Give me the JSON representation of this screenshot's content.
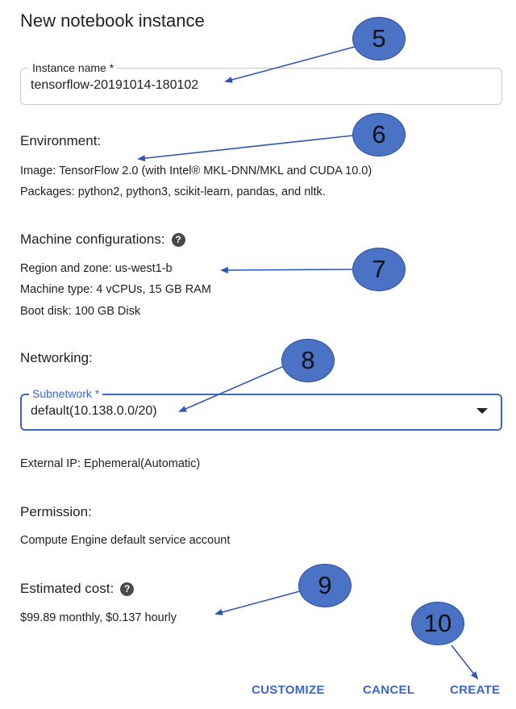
{
  "title": "New notebook instance",
  "instance_name": {
    "label": "Instance name *",
    "value": "tensorflow-20191014-180102"
  },
  "environment": {
    "heading": "Environment:",
    "image": "Image: TensorFlow 2.0 (with Intel® MKL-DNN/MKL and CUDA 10.0)",
    "packages": "Packages: python2, python3, scikit-learn, pandas, and nltk."
  },
  "machine": {
    "heading": "Machine configurations:",
    "help_icon": "?",
    "region": "Region and zone: us-west1-b",
    "type": "Machine type: 4 vCPUs, 15 GB RAM",
    "disk": "Boot disk: 100 GB Disk"
  },
  "networking": {
    "heading": "Networking:",
    "subnetwork_label": "Subnetwork *",
    "subnetwork_value": "default(10.138.0.0/20)",
    "external_ip": "External IP: Ephemeral(Automatic)"
  },
  "permission": {
    "heading": "Permission:",
    "account": "Compute Engine default service account"
  },
  "cost": {
    "heading": "Estimated cost:",
    "help_icon": "?",
    "value": "$99.89 monthly, $0.137 hourly"
  },
  "buttons": {
    "customize": "CUSTOMIZE",
    "cancel": "CANCEL",
    "create": "CREATE"
  },
  "callouts": {
    "c5": "5",
    "c6": "6",
    "c7": "7",
    "c8": "8",
    "c9": "9",
    "c10": "10"
  },
  "colors": {
    "accent": "#3a67c4",
    "callout_fill": "#4a73c6",
    "arrow": "#2f57b5"
  }
}
